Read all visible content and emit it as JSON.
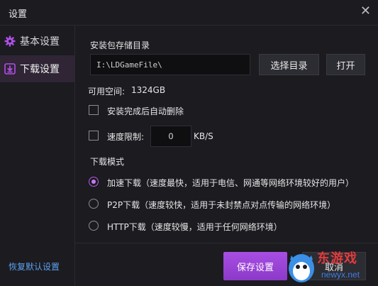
{
  "window": {
    "title": "设置",
    "close_glyph": "✕"
  },
  "sidebar": {
    "items": [
      {
        "label": "基本设置",
        "icon": "gear-icon"
      },
      {
        "label": "下载设置",
        "icon": "download-icon",
        "active": true
      }
    ],
    "restore_defaults": "恢复默认设置"
  },
  "download": {
    "dir_label": "安装包存储目录",
    "dir_value": "I:\\LDGameFile\\",
    "choose_dir_button": "选择目录",
    "open_button": "打开",
    "free_space_label": "可用空间:",
    "free_space_value": "1324GB",
    "auto_delete_label": "安装完成后自动删除",
    "auto_delete_checked": false,
    "speed_limit_label": "速度限制:",
    "speed_limit_checked": false,
    "speed_value": "0",
    "speed_unit": "KB/S",
    "mode_label": "下载模式",
    "modes": [
      {
        "label": "加速下载（速度最快，适用于电信、网通等网络环境较好的用户）",
        "selected": true
      },
      {
        "label": "P2P下载（速度较快，适用于未封禁点对点传输的网络环境）",
        "selected": false
      },
      {
        "label": "HTTP下载（速度较慢，适用于任何网络环境）",
        "selected": false
      }
    ]
  },
  "footer": {
    "save_button": "保存设置",
    "cancel_button": "取消"
  },
  "watermark": {
    "brand": "东游戏",
    "url": "newyx.net"
  },
  "colors": {
    "accent": "#a84ee3",
    "link": "#5ea0ee",
    "background": "#1b1b20"
  }
}
